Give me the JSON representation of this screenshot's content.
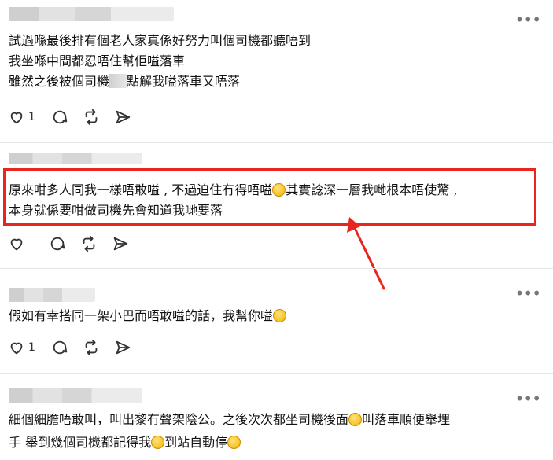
{
  "post1": {
    "lines": [
      "試過喺最後排有個老人家真係好努力叫個司機都聽唔到",
      "我坐喺中間都忍唔住幫佢嗌落車",
      "雖然之後被個司機",
      "點解我嗌落車又唔落"
    ],
    "likes": "1"
  },
  "post2": {
    "lines": [
      "原來咁多人同我一樣唔敢嗌 , 不過迫住冇得唔嗌",
      "其實諗深一層我哋根本唔使驚 ,",
      "本身就係要咁做司機先會知道我哋要落"
    ]
  },
  "post3": {
    "lines": [
      "假如有幸搭同一架小巴而唔敢嗌的話，我幫你嗌"
    ],
    "likes": "1"
  },
  "post4": {
    "lines": [
      "細個細膽唔敢叫，叫出黎冇聲架陰公。之後次次都坐司機後面",
      "叫落車順便舉埋",
      "手 舉到幾個司機都記得我",
      "到站自動停"
    ]
  },
  "colors": {
    "highlight": "#e8261d",
    "icon": "#333333"
  },
  "icons": [
    "heart-icon",
    "comment-icon",
    "repost-icon",
    "share-icon",
    "more-icon"
  ]
}
